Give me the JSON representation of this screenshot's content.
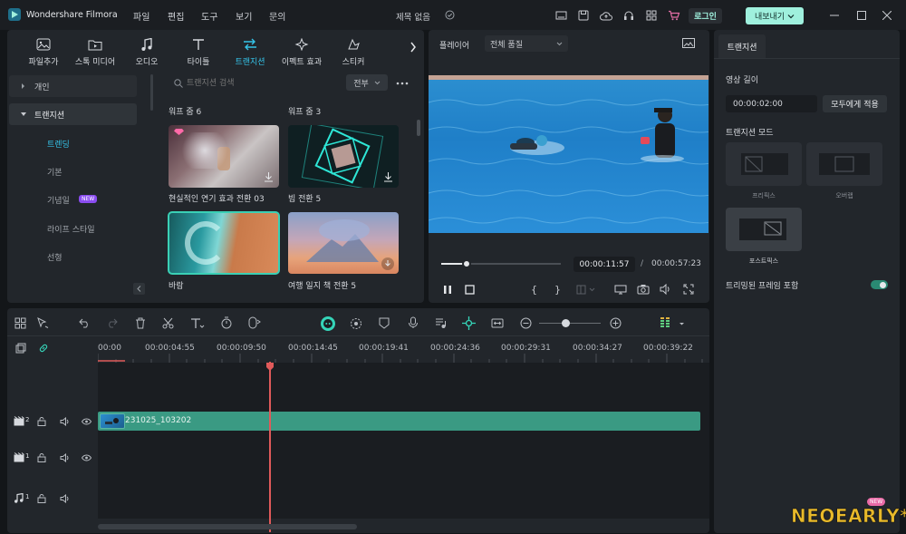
{
  "app": {
    "name": "Wondershare Filmora",
    "doc_title": "제목 없음",
    "login": "로그인",
    "export": "내보내기"
  },
  "menu": [
    "파일",
    "편집",
    "도구",
    "보기",
    "문의"
  ],
  "toolbar": [
    "파일추가",
    "스톡 미디어",
    "오디오",
    "타이틀",
    "트랜지션",
    "이펙트 효과",
    "스티커"
  ],
  "sidebar": {
    "items": [
      "개인",
      "트랜지션",
      "트렌딩",
      "기본",
      "기념일",
      "라이프 스타일",
      "선형"
    ],
    "new_badge": "NEW"
  },
  "search": {
    "placeholder": "트랜지션 검색",
    "filter": "전부"
  },
  "categories": [
    "워프 줌 6",
    "워프 줌 3"
  ],
  "thumbs": [
    "현실적인 연기 효과 전환 03",
    "빔 전환 5",
    "바람",
    "여행 일지 책 전환 5"
  ],
  "player": {
    "label": "플레이어",
    "quality": "전체 품질",
    "current": "00:00:11:57",
    "separator": "/",
    "total": "00:00:57:23",
    "progress": 0.21
  },
  "props": {
    "tab": "트랜지션",
    "duration_label": "영상 길이",
    "duration": "00:00:02:00",
    "apply_all": "모두에게 적용",
    "mode_label": "트랜지션 모드",
    "modes": [
      "프리픽스",
      "오버랩",
      "포스트픽스"
    ],
    "trim_label": "트리밍된 프레임 포함"
  },
  "timeline": {
    "ticks": [
      "00:00",
      "00:00:04:55",
      "00:00:09:50",
      "00:00:14:45",
      "00:00:19:41",
      "00:00:24:36",
      "00:00:29:31",
      "00:00:34:27",
      "00:00:39:22"
    ],
    "clip": "231025_103202",
    "tracks": [
      "2",
      "1",
      "1"
    ]
  },
  "watermark": {
    "text": "NEOEARLY*",
    "badge": "NEW"
  },
  "colors": {
    "accent": "#35c3e8",
    "clip": "#3a9a83",
    "playhead": "#e05a5a",
    "export": "#9ff0dd"
  }
}
